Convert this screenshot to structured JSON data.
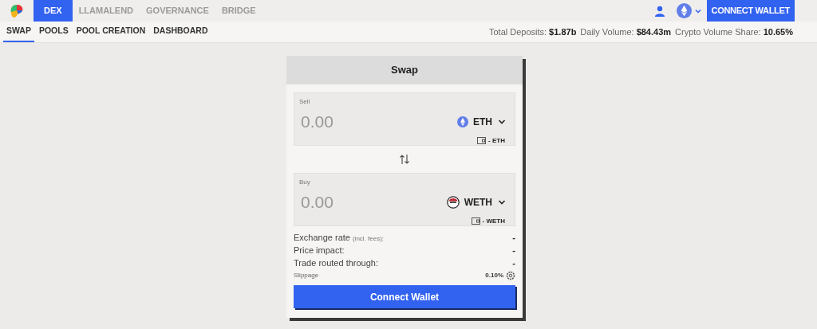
{
  "top_nav": {
    "items": [
      {
        "label": "DEX",
        "selected": true
      },
      {
        "label": "LLAMALEND",
        "selected": false
      },
      {
        "label": "GOVERNANCE",
        "selected": false
      },
      {
        "label": "BRIDGE",
        "selected": false
      }
    ],
    "connect_button": "CONNECT WALLET"
  },
  "sub_nav": {
    "items": [
      {
        "label": "SWAP",
        "selected": true
      },
      {
        "label": "POOLS",
        "selected": false
      },
      {
        "label": "POOL CREATION",
        "selected": false
      },
      {
        "label": "DASHBOARD",
        "selected": false
      }
    ]
  },
  "stats": [
    {
      "label": "Total Deposits:",
      "value": "$1.87b"
    },
    {
      "label": "Daily Volume:",
      "value": "$84.43m"
    },
    {
      "label": "Crypto Volume Share:",
      "value": "10.65%"
    }
  ],
  "swap": {
    "title": "Swap",
    "fields": [
      {
        "label": "Sell",
        "placeholder": "0.00",
        "token": "ETH",
        "kind": "eth",
        "balance": "- ETH"
      },
      {
        "label": "Buy",
        "placeholder": "0.00",
        "token": "WETH",
        "kind": "weth",
        "balance": "- WETH"
      }
    ],
    "details": [
      {
        "label": "Exchange rate",
        "note": "(incl. fees):",
        "value": "-"
      },
      {
        "label": "Price impact:",
        "value": "-"
      },
      {
        "label": "Trade routed through:",
        "value": "-"
      }
    ],
    "slippage": {
      "label": "Slippage",
      "value": "0.10%"
    },
    "button": "Connect Wallet"
  }
}
